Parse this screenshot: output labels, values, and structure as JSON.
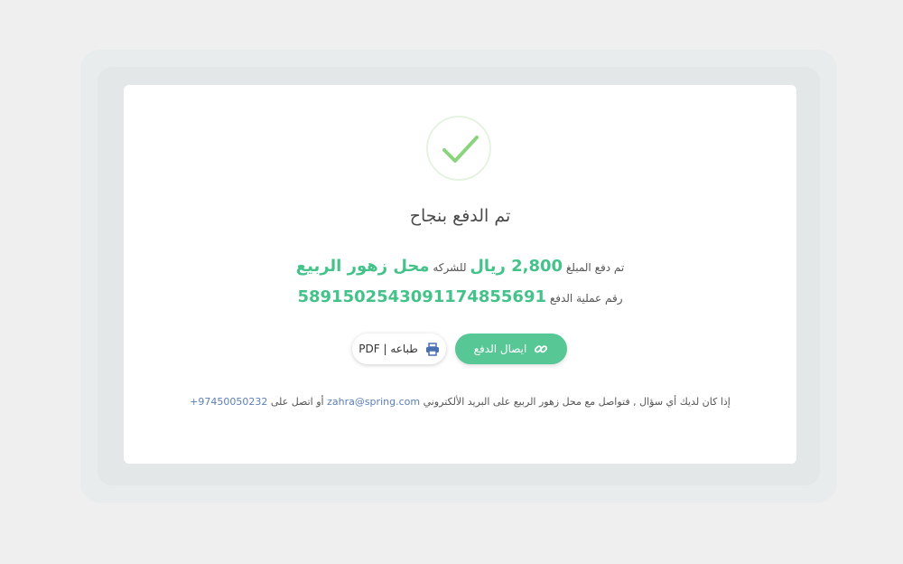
{
  "status": {
    "title": "تم الدفع بنجاح",
    "icon": "checkmark-icon",
    "accent_color": "#43c289"
  },
  "payment": {
    "paid_label": "تم دفع المبلغ",
    "amount": "2,800 ريال",
    "company_label": "للشركه",
    "company_name": "محل زهور الربيع",
    "transaction_label": "رقم عملية الدفع",
    "transaction_number": "58915025430911748556​91"
  },
  "actions": {
    "receipt_label": "ايصال الدفع",
    "receipt_icon": "link-icon",
    "print_label": "طباعه | PDF",
    "print_icon": "printer-icon"
  },
  "contact": {
    "text_prefix": "إذا كان لديك أي سؤال , فتواصل مع محل زهور الربيع على البريد الألكتروني",
    "email": "zahra@spring.com",
    "text_middle": "أو اتصل على",
    "phone": "+97450050232"
  }
}
